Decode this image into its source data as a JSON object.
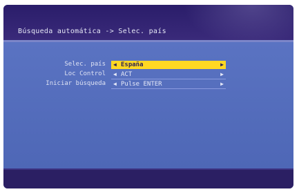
{
  "header": {
    "title": "Búsqueda automática -> Selec. país"
  },
  "rows": [
    {
      "label": "Selec. país",
      "value": "España",
      "selected": true
    },
    {
      "label": "Loc Control",
      "value": "ACT",
      "selected": false
    },
    {
      "label": "Iniciar búsqueda",
      "value": "Pulse ENTER",
      "selected": false
    }
  ],
  "icons": {
    "left": "arrow-left",
    "right": "arrow-right"
  },
  "colors": {
    "highlight": "#ffd823",
    "background": "#4a5fae",
    "header": "#2a1d6a"
  }
}
